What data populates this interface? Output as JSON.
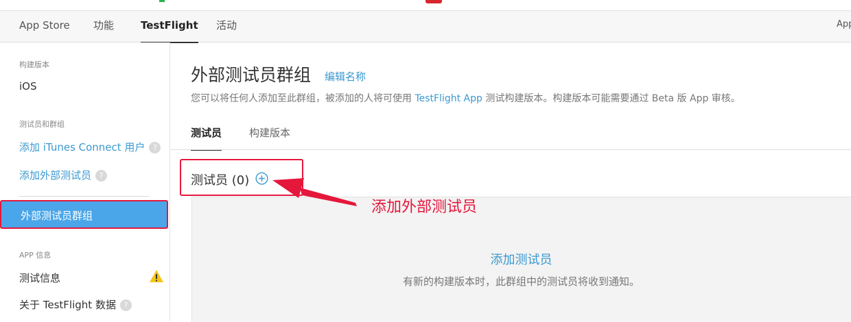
{
  "header": {
    "nav": [
      "App Store",
      "功能",
      "TestFlight",
      "活动"
    ],
    "active_nav": "TestFlight",
    "right_text": "App"
  },
  "sidebar": {
    "build_heading": "构建版本",
    "build_item": "iOS",
    "testers_heading": "测试员和群组",
    "add_itunes": "添加 iTunes Connect 用户",
    "add_external": "添加外部测试员",
    "active_group": "外部测试员群组",
    "app_info_heading": "APP 信息",
    "test_info": "测试信息",
    "about_data": "关于 TestFlight 数据",
    "help_glyph": "?"
  },
  "main": {
    "title": "外部测试员群组",
    "edit_link": "编辑名称",
    "desc_before": "您可以将任何人添加至此群组，被添加的人将可使用",
    "desc_link": "TestFlight App",
    "desc_after": "测试构建版本。构建版本可能需要通过 Beta 版 App 审核。",
    "tabs": [
      "测试员",
      "构建版本"
    ],
    "testers_label": "测试员 (0)",
    "empty_title": "添加测试员",
    "empty_desc": "有新的构建版本时，此群组中的测试员将收到通知。"
  },
  "annotation": {
    "text": "添加外部测试员",
    "color": "#e5173b"
  },
  "icons": {
    "add": "plus-circle-icon",
    "warning": "warning-icon",
    "help": "help-icon",
    "arrow": "annotation-arrow-icon"
  },
  "colors": {
    "link": "#3a99d0",
    "active_bg": "#4aa6e8",
    "highlight_red": "#e5173b",
    "warning": "#f5c518"
  }
}
